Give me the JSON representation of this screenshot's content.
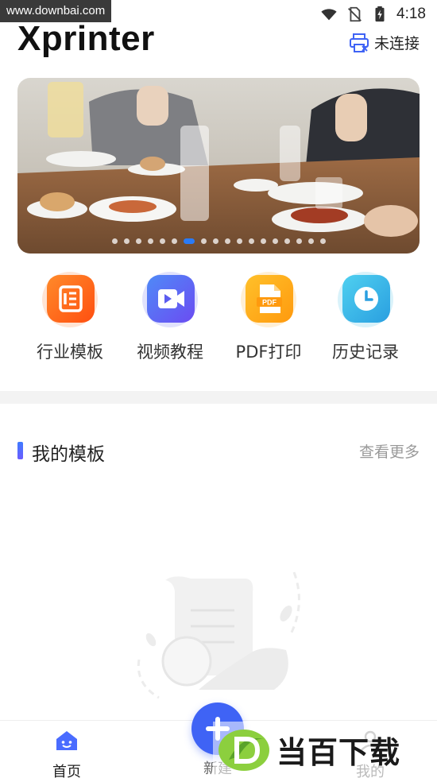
{
  "watermark_top": "www.downbai.com",
  "status_bar": {
    "time": "4:18",
    "icons": [
      "wifi-icon",
      "no-sim-icon",
      "battery-charging-icon"
    ]
  },
  "header": {
    "title": "Xprinter",
    "connection_label": "未连接",
    "connection_icon": "printer-disconnected-icon"
  },
  "banner": {
    "slide_count": 18,
    "active_index": 6
  },
  "actions": [
    {
      "label": "行业模板",
      "icon": "template-list-icon",
      "color": "#ff6a10"
    },
    {
      "label": "视频教程",
      "icon": "video-camera-icon",
      "color": "#5b5cf0"
    },
    {
      "label": "PDF打印",
      "icon": "pdf-file-icon",
      "color": "#ffa616"
    },
    {
      "label": "历史记录",
      "icon": "clock-icon",
      "color": "#2fb6e6"
    }
  ],
  "section": {
    "title": "我的模板",
    "more_label": "查看更多",
    "accent": "#4a6cff"
  },
  "tabbar": {
    "tabs": [
      {
        "label": "首页",
        "icon": "home-icon",
        "active": true
      },
      {
        "label": "新建",
        "icon": "add-icon",
        "active": false
      },
      {
        "label": "我的",
        "icon": "profile-icon",
        "active": false
      }
    ]
  },
  "watermark_bottom": "当百下载",
  "colors": {
    "primary": "#3f63f5",
    "muted_text": "#9a9a9a",
    "band": "#f3f3f3"
  }
}
